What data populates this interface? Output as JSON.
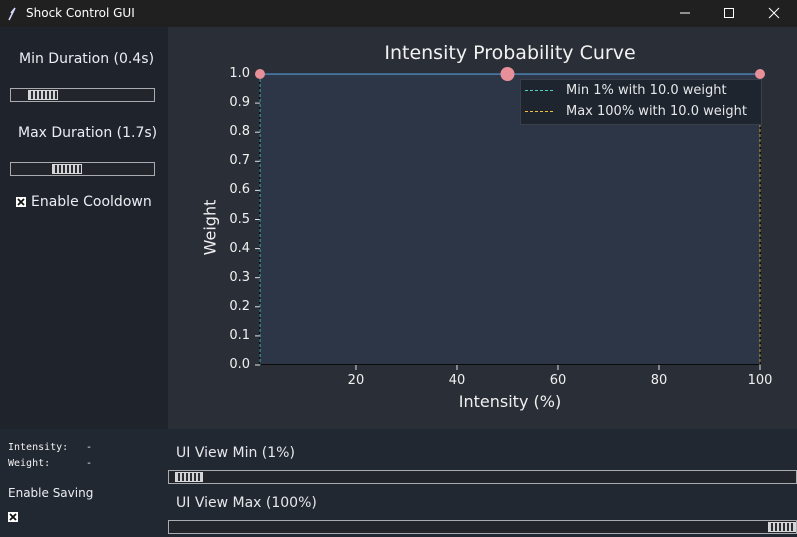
{
  "window": {
    "title": "Shock Control GUI",
    "icon": "feather-icon",
    "controls": [
      "minimize-icon",
      "maximize-icon",
      "close-icon"
    ]
  },
  "sidebar": {
    "min_duration_label": "Min Duration (0.4s)",
    "min_duration_slider_fraction": 0.15,
    "max_duration_label": "Max Duration (1.7s)",
    "max_duration_slider_fraction": 0.36,
    "cooldown_label": "Enable Cooldown",
    "cooldown_checked": true,
    "intensity_label": "Intensity:",
    "intensity_value": "-",
    "weight_label": "Weight:",
    "weight_value": "-",
    "saving_label": "Enable Saving",
    "saving_checked": true
  },
  "chart_data": {
    "type": "line",
    "title": "Intensity Probability Curve",
    "xlabel": "Intensity (%)",
    "ylabel": "Weight",
    "xlim": [
      1,
      100
    ],
    "ylim": [
      0.0,
      1.0
    ],
    "xticks": [
      "20",
      "40",
      "60",
      "80",
      "100"
    ],
    "yticks": [
      "0.0",
      "0.1",
      "0.2",
      "0.3",
      "0.4",
      "0.5",
      "0.6",
      "0.7",
      "0.8",
      "0.9",
      "1.0"
    ],
    "grid": false,
    "legend_position": "top-right",
    "series": [
      {
        "name": "curve",
        "x": [
          1,
          50,
          100
        ],
        "y": [
          1.0,
          1.0,
          1.0
        ],
        "color": "#5b9bd5"
      }
    ],
    "points": [
      {
        "x": 1,
        "y": 1.0,
        "color": "#e8909a"
      },
      {
        "x": 50,
        "y": 1.0,
        "color": "#e8909a"
      },
      {
        "x": 100,
        "y": 1.0,
        "color": "#e8909a"
      }
    ],
    "legend": [
      {
        "label": "Min 1% with 10.0 weight",
        "color": "#4fd1c5"
      },
      {
        "label": "Max 100% with 10.0 weight",
        "color": "#f0c040"
      }
    ]
  },
  "bottom": {
    "view_min_label": "UI View Min (1%)",
    "view_min_fraction": 0.01,
    "view_max_label": "UI View Max (100%)",
    "view_max_fraction": 1.0
  }
}
